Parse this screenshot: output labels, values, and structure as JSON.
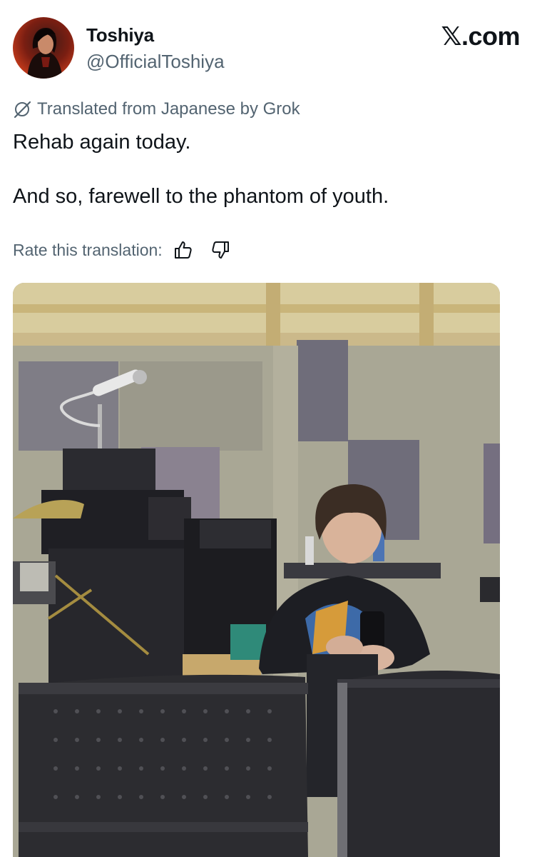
{
  "header": {
    "display_name": "Toshiya",
    "handle": "@OfficialToshiya",
    "brand": "𝕏.com",
    "avatar_icon": "profile-avatar"
  },
  "translation": {
    "label": "Translated from Japanese by Grok",
    "icon": "grok-icon",
    "rate_label": "Rate this translation:",
    "thumbs_up_icon": "thumbs-up-icon",
    "thumbs_down_icon": "thumbs-down-icon"
  },
  "tweet": {
    "text": "Rehab again today.\n\nAnd so, farewell to the phantom of youth."
  },
  "media": {
    "type": "photo"
  },
  "colors": {
    "text": "#0f1419",
    "secondary": "#536471",
    "background": "#ffffff"
  }
}
